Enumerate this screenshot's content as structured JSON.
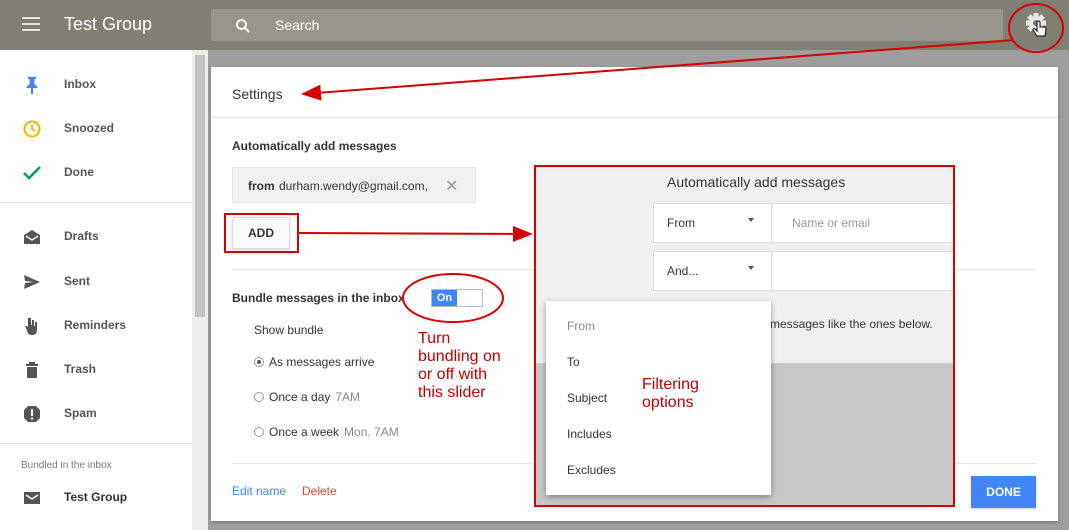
{
  "app": {
    "title": "Test Group"
  },
  "search": {
    "placeholder": "Search"
  },
  "sidebar": {
    "items": [
      {
        "label": "Inbox"
      },
      {
        "label": "Snoozed"
      },
      {
        "label": "Done"
      },
      {
        "label": "Drafts"
      },
      {
        "label": "Sent"
      },
      {
        "label": "Reminders"
      },
      {
        "label": "Trash"
      },
      {
        "label": "Spam"
      }
    ],
    "section_label": "Bundled in the inbox",
    "bundle_item": {
      "label": "Test Group"
    }
  },
  "settings": {
    "title": "Settings",
    "auto_add": {
      "title": "Automatically add messages",
      "chip": {
        "prefix": "from",
        "value": "durham.wendy@gmail.com,"
      },
      "add_label": "ADD"
    },
    "bundle": {
      "label": "Bundle messages in the inbox",
      "toggle_label": "On",
      "toggle_state": "on",
      "show_bundle_label": "Show bundle",
      "options": [
        {
          "label": "As messages arrive",
          "sub": "",
          "selected": true
        },
        {
          "label": "Once a day",
          "sub": "7AM",
          "selected": false
        },
        {
          "label": "Once a week",
          "sub": "Mon, 7AM",
          "selected": false
        }
      ]
    },
    "edit_name_label": "Edit name",
    "delete_label": "Delete",
    "done_label": "DONE"
  },
  "zoom_panel": {
    "title": "Automatically add messages",
    "row1_select": "From",
    "row1_placeholder": "Name or email",
    "row2_select": "And...",
    "hint_text": "messages like the ones below."
  },
  "dropdown": {
    "items": [
      "From",
      "To",
      "Subject",
      "Includes",
      "Excludes"
    ]
  },
  "annotations": {
    "slider_note": [
      "Turn",
      "bundling on",
      "or off with",
      "this slider"
    ],
    "filter_note": [
      "Filtering",
      "options"
    ]
  },
  "colors": {
    "topbar": "#7f7f73",
    "accent_blue": "#4285f4",
    "annotation_red": "#d50000",
    "delete_red": "#db4437"
  }
}
